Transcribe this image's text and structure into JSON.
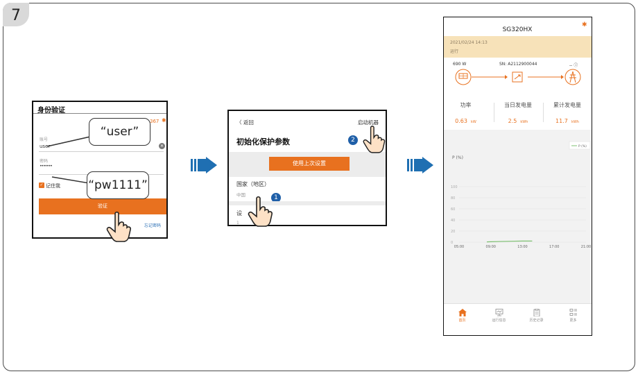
{
  "step_number": "7",
  "screen1": {
    "title": "身份验证",
    "status_fragment": "367",
    "account_label": "账号",
    "account_value": "user",
    "password_label": "密码",
    "password_value": "•••••••",
    "remember_label": "记住我",
    "verify_button": "验证",
    "forgot_link": "忘记密码",
    "bubble_user": "“user”",
    "bubble_password": "“pw1111”"
  },
  "screen2": {
    "back_label": "〈 返回",
    "start_button": "启动机器",
    "title": "初始化保护参数",
    "use_last_button": "使用上次设置",
    "country_label": "国家（地区）",
    "country_value": "中国",
    "device_label_fragment": "设",
    "device_value_fragment": "1",
    "marker_1": "1",
    "marker_2": "2"
  },
  "screen3": {
    "title": "SG320HX",
    "datetime": "2021/02/24 14:13",
    "state": "运行",
    "power_flow_value": "690  W",
    "serial": "SN: A2112900044",
    "grid_value": "-- ⓘ",
    "stats": [
      {
        "label": "功率",
        "value": "0.63",
        "unit": "kW"
      },
      {
        "label": "当日发电量",
        "value": "2.5",
        "unit": "kWh"
      },
      {
        "label": "累计发电量",
        "value": "11.7",
        "unit": "kWh"
      }
    ],
    "tabs": [
      {
        "label": "首页",
        "active": true
      },
      {
        "label": "运行信息",
        "active": false
      },
      {
        "label": "历史记录",
        "active": false
      },
      {
        "label": "更多",
        "active": false
      }
    ]
  },
  "chart_data": {
    "type": "line",
    "title": "",
    "ylabel": "P (%)",
    "xlabel": "",
    "ylim": [
      0,
      100
    ],
    "yticks": [
      "0",
      "20",
      "40",
      "60",
      "80",
      "100"
    ],
    "xticks": [
      "05:00",
      "09:00",
      "13:00",
      "17:00",
      "21:00"
    ],
    "legend_position": "top-right",
    "grid": true,
    "series": [
      {
        "name": "P (%)",
        "color": "#7cc070",
        "x": [
          "08:30",
          "09:00",
          "10:00",
          "11:00",
          "12:00",
          "13:00",
          "14:13"
        ],
        "y": [
          0.5,
          0.8,
          1.2,
          1.5,
          1.8,
          2.0,
          2.0
        ]
      }
    ]
  },
  "colors": {
    "accent": "#e8711f",
    "arrow_blue": "#1f6fb2",
    "status_bar": "#f7e2b9",
    "chart_line": "#7cc070"
  }
}
